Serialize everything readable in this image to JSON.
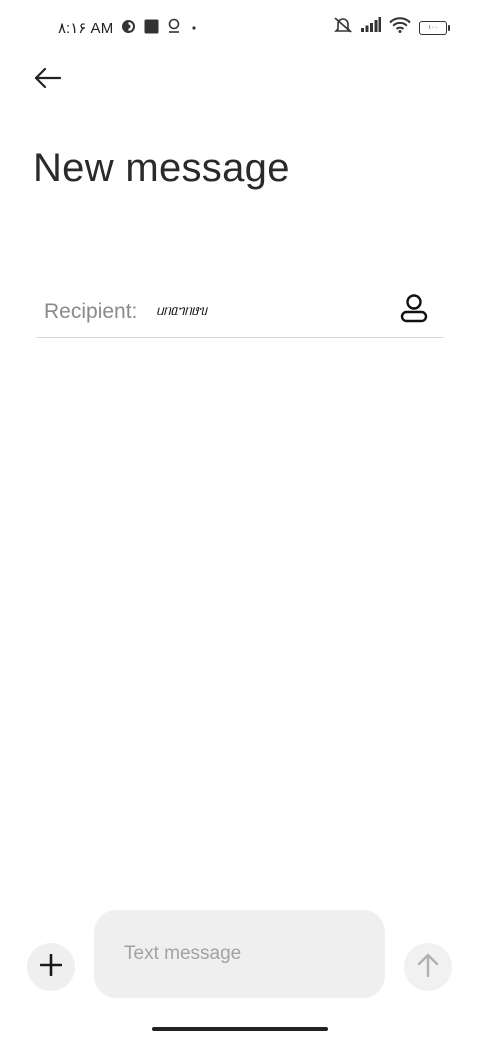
{
  "status_bar": {
    "time": "۸:۱۶ AM",
    "left_icons": [
      "app-notification-icon",
      "stop-square-icon",
      "location-icon",
      "dot-icon"
    ],
    "right_icons": [
      "silent-mode-icon",
      "signal-bars-icon",
      "wifi-icon",
      "battery-icon"
    ],
    "battery_text": "۱۰۰"
  },
  "header": {
    "back_icon": "arrow-left-icon",
    "title": "New message"
  },
  "recipient": {
    "label": "Recipient:",
    "value": "ᥙᥒᥲᥐᥒᥳᥔ",
    "contact_icon": "person-icon"
  },
  "composer": {
    "add_icon": "plus-icon",
    "placeholder": "Text message",
    "value": "",
    "send_icon": "arrow-up-icon"
  },
  "colors": {
    "background": "#ffffff",
    "input_background": "#efefef",
    "placeholder": "#a3a3a3",
    "label": "#8a8a8a"
  }
}
